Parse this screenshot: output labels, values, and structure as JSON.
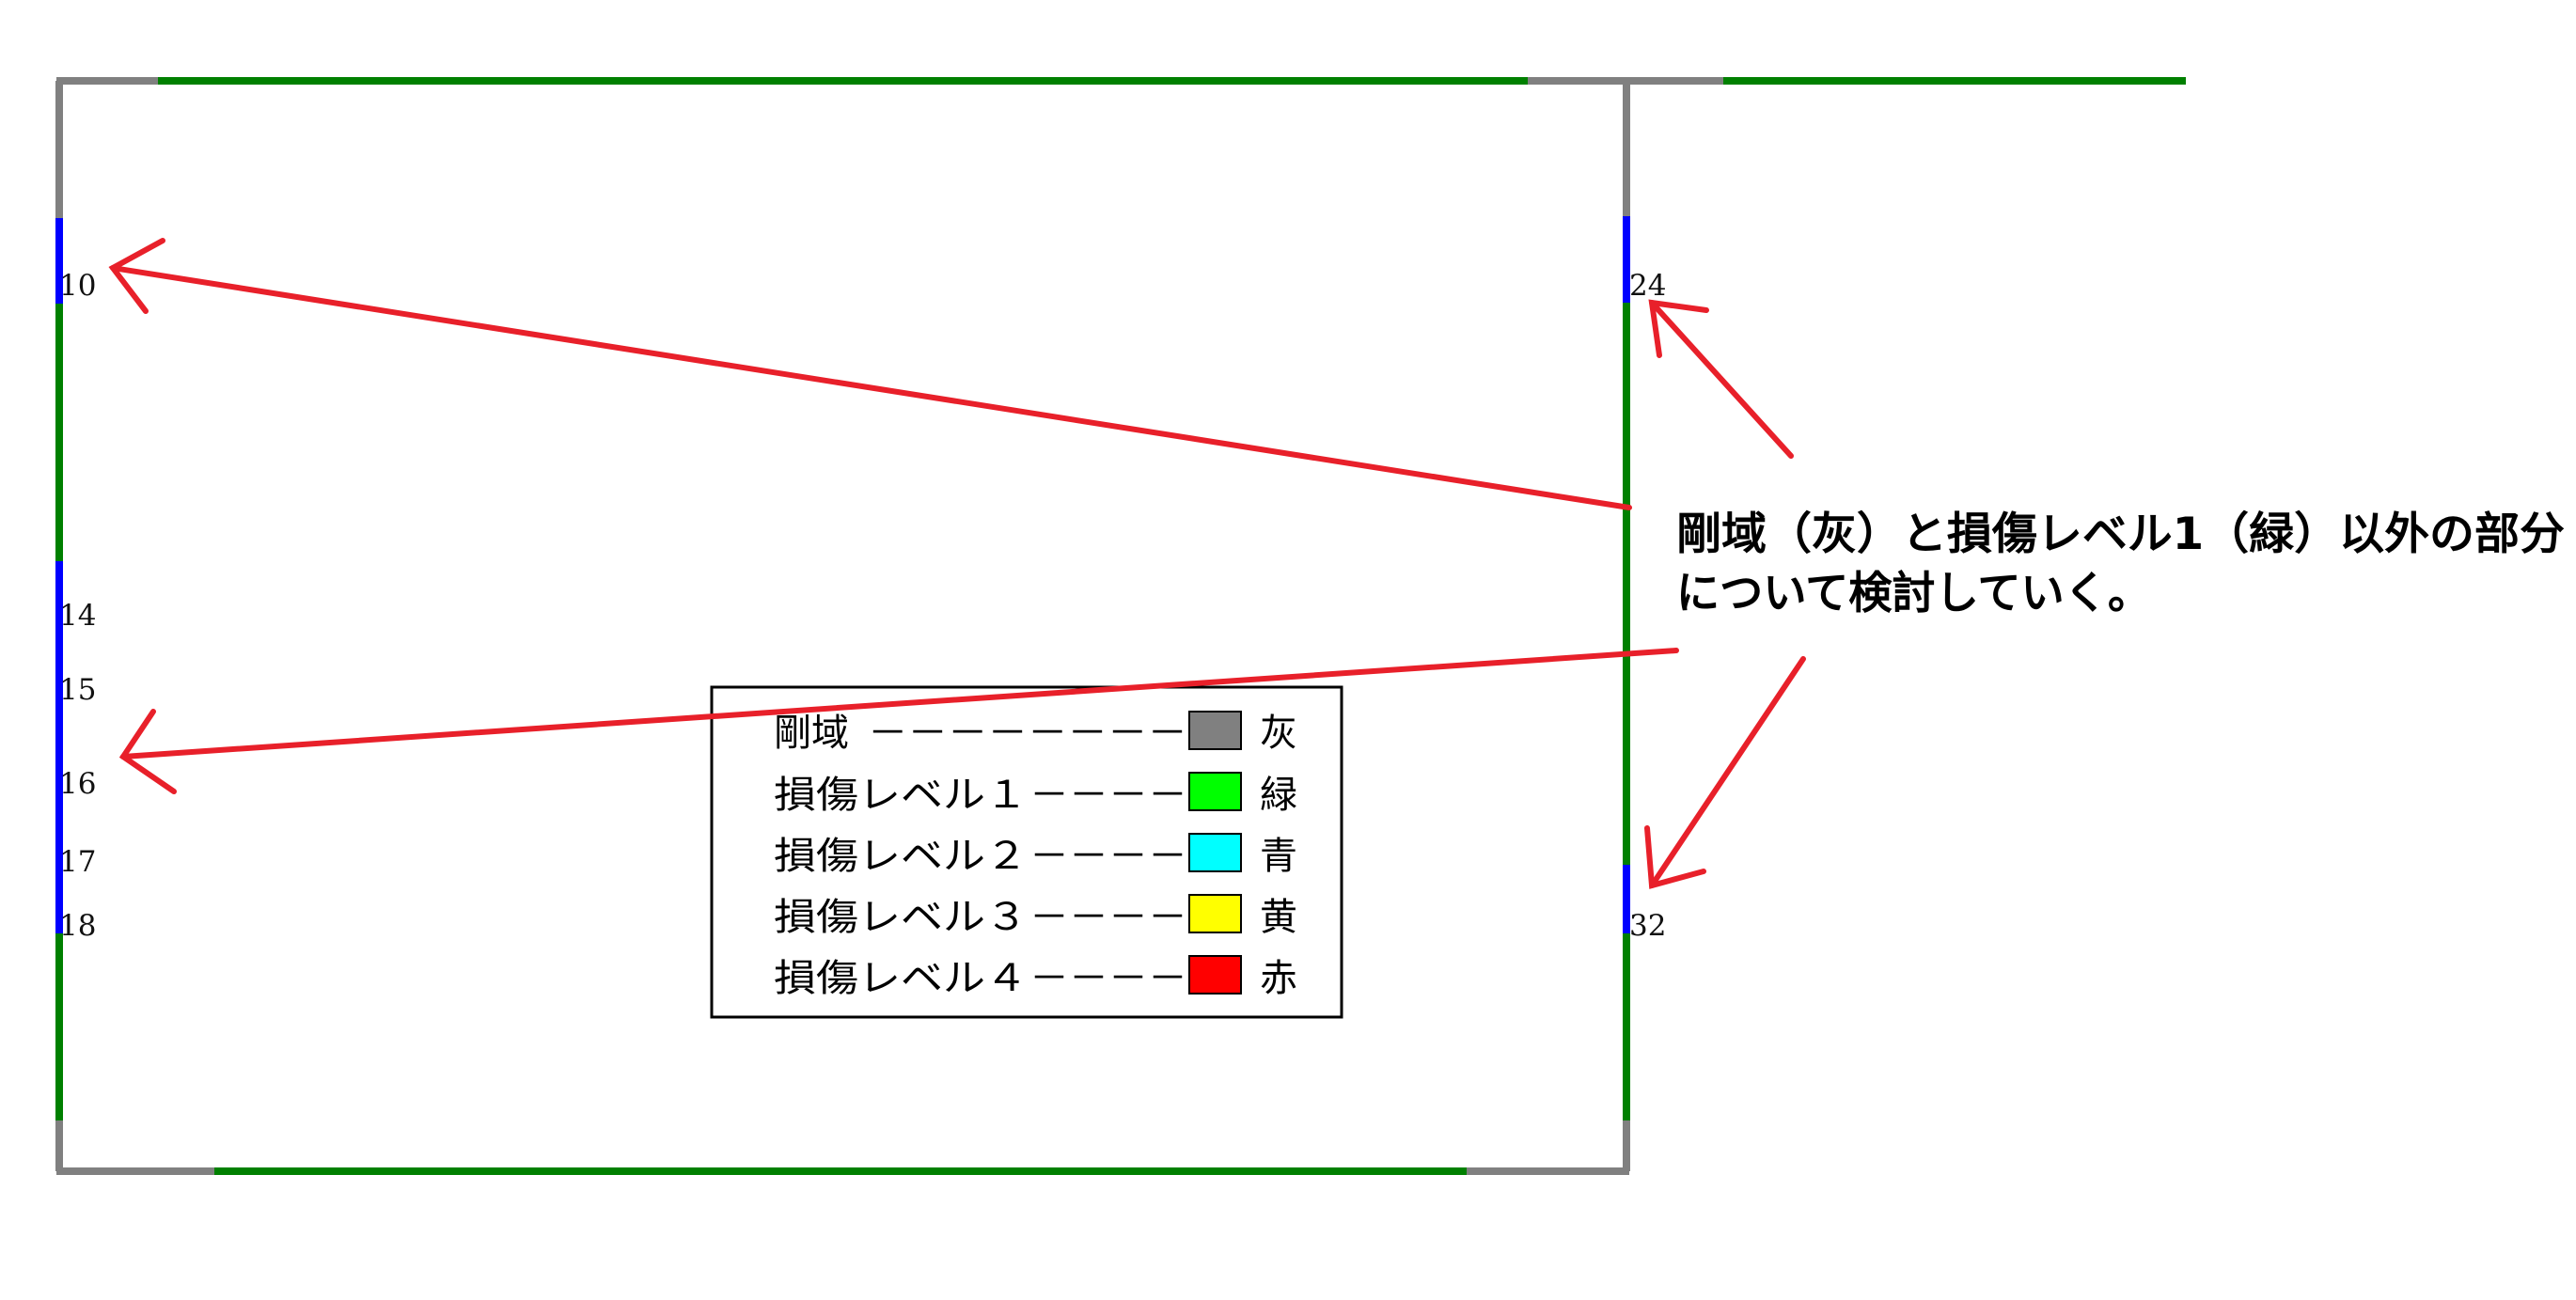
{
  "colors": {
    "gray": "#808080",
    "green": "#008000",
    "blue": "#0000ff",
    "arrow_red": "#e8202a",
    "legend_gray": "#808080",
    "legend_green": "#00ff00",
    "legend_cyan": "#00ffff",
    "legend_yellow": "#ffff00",
    "legend_red": "#ff0000"
  },
  "node_labels": [
    "10",
    "14",
    "15",
    "16",
    "17",
    "18",
    "24",
    "32"
  ],
  "legend": {
    "items": [
      {
        "label": "剛域",
        "dashes": "－－－－－－－－",
        "swatch": "legend_gray",
        "color_name": "灰"
      },
      {
        "label": "損傷レベル１",
        "dashes": "－－－－",
        "swatch": "legend_green",
        "color_name": "緑"
      },
      {
        "label": "損傷レベル２",
        "dashes": "－－－－",
        "swatch": "legend_cyan",
        "color_name": "青"
      },
      {
        "label": "損傷レベル３",
        "dashes": "－－－－",
        "swatch": "legend_yellow",
        "color_name": "黄"
      },
      {
        "label": "損傷レベル４",
        "dashes": "－－－－",
        "swatch": "legend_red",
        "color_name": "赤"
      }
    ]
  },
  "annotation": {
    "line1": "剛域（灰）と損傷レベル1（緑）以外の部分",
    "line2": "について検討していく。"
  }
}
